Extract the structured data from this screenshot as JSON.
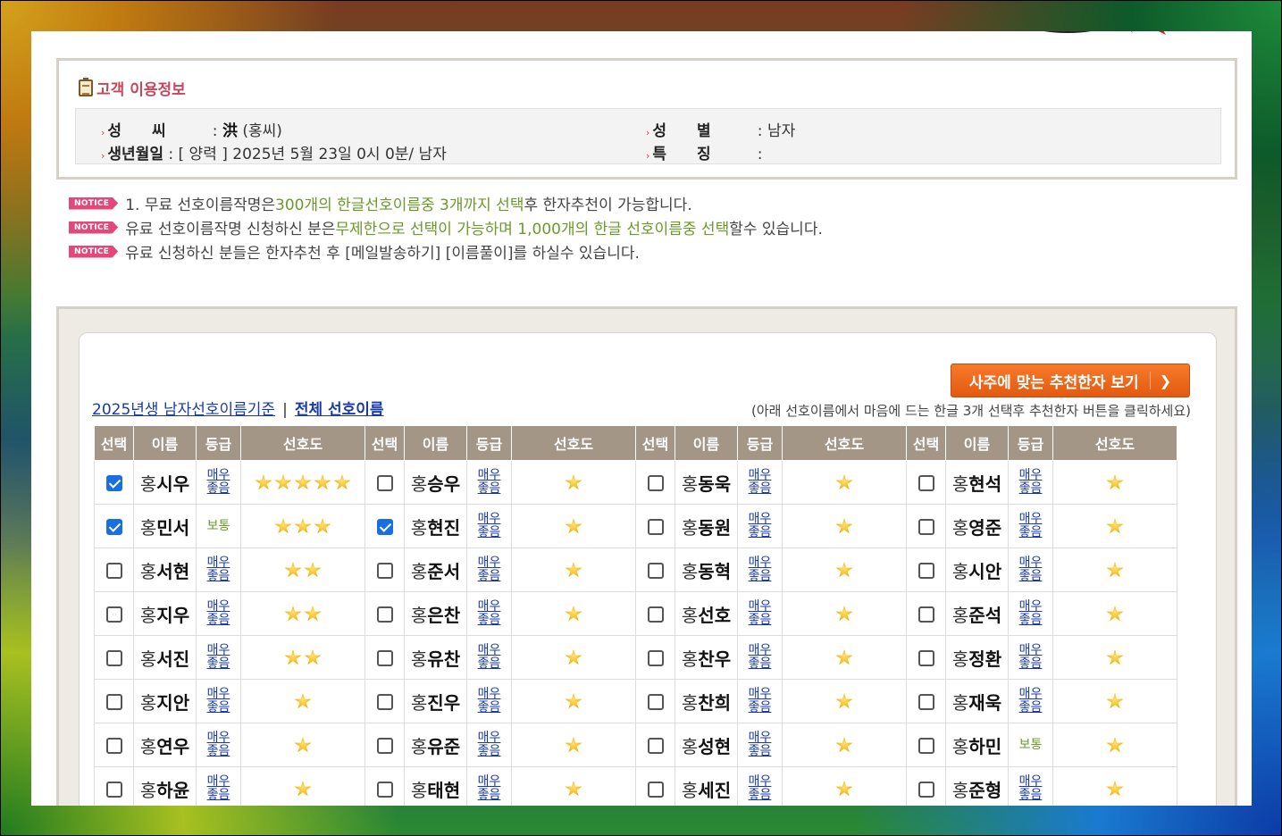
{
  "customer_info": {
    "title": "고객 이용정보",
    "surname_label": "성　　씨",
    "surname_hanja": "洪",
    "surname_hangul": "(홍씨)",
    "gender_label": "성　　별",
    "gender_value": "남자",
    "birth_label": "생년월일",
    "birth_value": "[ 양력 ] 2025년 5월 23일 0시 0분/ 남자",
    "trait_label": "특　　징",
    "trait_value": ""
  },
  "notices": {
    "badge": "NOTICE",
    "line1": {
      "a": "1. 무료 선호이름작명은 ",
      "b": "300개의 한글선호이름중 3개까지 선택",
      "c": "후 한자추천이 가능합니다."
    },
    "line2": {
      "a": "유료 선호이름작명 신청하신 분은",
      "b": "무제한으로 선택이 가능하며 1,000개의 한글 선호이름중 선택",
      "c": "할수 있습니다."
    },
    "line3": {
      "a": "유료 신청하신 분들은 한자추천 후 [메일발송하기] [이름풀이]를 하실수 있습니다."
    }
  },
  "selection": {
    "hanja_button": "사주에 맞는 추천한자 보기",
    "link1": "2025년생 남자선호이름기준",
    "separator": "|",
    "link2": "전체 선호이름",
    "hint": "(아래 선호이름에서 마음에 드는 한글 3개 선택후 추천한자 버튼을 클릭하세요)",
    "headers": [
      "선택",
      "이름",
      "등급",
      "선호도"
    ],
    "surname": "홍",
    "grade_good": "매우\n좋음",
    "grade_normal": "보통",
    "rows": [
      [
        {
          "n": "시우",
          "c": true,
          "g": "good",
          "s": 5
        },
        {
          "n": "승우",
          "c": false,
          "g": "good",
          "s": 1
        },
        {
          "n": "동욱",
          "c": false,
          "g": "good",
          "s": 1
        },
        {
          "n": "현석",
          "c": false,
          "g": "good",
          "s": 1
        }
      ],
      [
        {
          "n": "민서",
          "c": true,
          "g": "normal",
          "s": 3
        },
        {
          "n": "현진",
          "c": true,
          "g": "good",
          "s": 1
        },
        {
          "n": "동원",
          "c": false,
          "g": "good",
          "s": 1
        },
        {
          "n": "영준",
          "c": false,
          "g": "good",
          "s": 1
        }
      ],
      [
        {
          "n": "서현",
          "c": false,
          "g": "good",
          "s": 2
        },
        {
          "n": "준서",
          "c": false,
          "g": "good",
          "s": 1
        },
        {
          "n": "동혁",
          "c": false,
          "g": "good",
          "s": 1
        },
        {
          "n": "시안",
          "c": false,
          "g": "good",
          "s": 1
        }
      ],
      [
        {
          "n": "지우",
          "c": false,
          "g": "good",
          "s": 2
        },
        {
          "n": "은찬",
          "c": false,
          "g": "good",
          "s": 1
        },
        {
          "n": "선호",
          "c": false,
          "g": "good",
          "s": 1
        },
        {
          "n": "준석",
          "c": false,
          "g": "good",
          "s": 1
        }
      ],
      [
        {
          "n": "서진",
          "c": false,
          "g": "good",
          "s": 2
        },
        {
          "n": "유찬",
          "c": false,
          "g": "good",
          "s": 1
        },
        {
          "n": "찬우",
          "c": false,
          "g": "good",
          "s": 1
        },
        {
          "n": "정환",
          "c": false,
          "g": "good",
          "s": 1
        }
      ],
      [
        {
          "n": "지안",
          "c": false,
          "g": "good",
          "s": 1
        },
        {
          "n": "진우",
          "c": false,
          "g": "good",
          "s": 1
        },
        {
          "n": "찬희",
          "c": false,
          "g": "good",
          "s": 1
        },
        {
          "n": "재욱",
          "c": false,
          "g": "good",
          "s": 1
        }
      ],
      [
        {
          "n": "연우",
          "c": false,
          "g": "good",
          "s": 1
        },
        {
          "n": "유준",
          "c": false,
          "g": "good",
          "s": 1
        },
        {
          "n": "성현",
          "c": false,
          "g": "good",
          "s": 1
        },
        {
          "n": "하민",
          "c": false,
          "g": "normal",
          "s": 1
        }
      ],
      [
        {
          "n": "하윤",
          "c": false,
          "g": "good",
          "s": 1
        },
        {
          "n": "태현",
          "c": false,
          "g": "good",
          "s": 1
        },
        {
          "n": "세진",
          "c": false,
          "g": "good",
          "s": 1
        },
        {
          "n": "준형",
          "c": false,
          "g": "good",
          "s": 1
        }
      ]
    ]
  },
  "colors": {
    "accent_pink": "#c4475c",
    "header_bg": "#a49686",
    "button_orange": "#f26a1b",
    "link_blue": "#1a3aa8",
    "green": "#6b9a2a"
  }
}
